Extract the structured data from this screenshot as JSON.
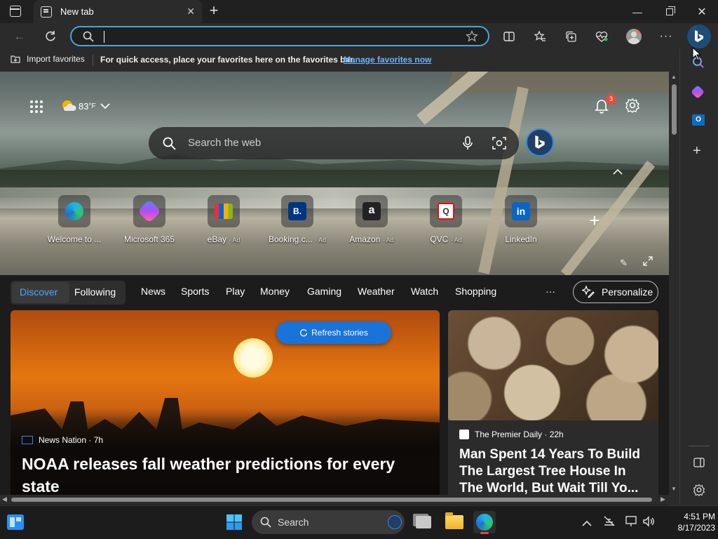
{
  "browser": {
    "tab_title": "New tab",
    "address_value": "",
    "import_favorites": "Import favorites",
    "favbar_message": "For quick access, place your favorites here on the favorites bar.",
    "manage_favorites": "Manage favorites now"
  },
  "newtab": {
    "weather_temp": "83",
    "weather_unit": "°F",
    "notification_count": "3",
    "search_placeholder": "Search the web",
    "shortcuts": [
      {
        "label": "Welcome to ...",
        "ad": ""
      },
      {
        "label": "Microsoft 365",
        "ad": ""
      },
      {
        "label": "eBay",
        "ad": "· Ad"
      },
      {
        "label": "Booking.c...",
        "ad": "· Ad"
      },
      {
        "label": "Amazon",
        "ad": "· Ad"
      },
      {
        "label": "QVC",
        "ad": "· Ad"
      },
      {
        "label": "LinkedIn",
        "ad": ""
      }
    ],
    "tabs": [
      "Discover",
      "Following",
      "News",
      "Sports",
      "Play",
      "Money",
      "Gaming",
      "Weather",
      "Watch",
      "Shopping"
    ],
    "more": "···",
    "personalize": "Personalize",
    "refresh_stories": "Refresh stories",
    "stories": [
      {
        "source": "News Nation · 7h",
        "headline": "NOAA releases fall weather predictions for every state"
      },
      {
        "source": "The Premier Daily · 22h",
        "headline": "Man Spent 14 Years To Build The Largest Tree House In The World, But Wait Till Yo..."
      }
    ]
  },
  "taskbar": {
    "search_label": "Search",
    "time": "4:51 PM",
    "date": "8/17/2023"
  },
  "colors": {
    "accent": "#4aa3df",
    "discover": "#4ea5ff",
    "refresh_button": "#1a73d9",
    "badge": "#e74c3c"
  }
}
